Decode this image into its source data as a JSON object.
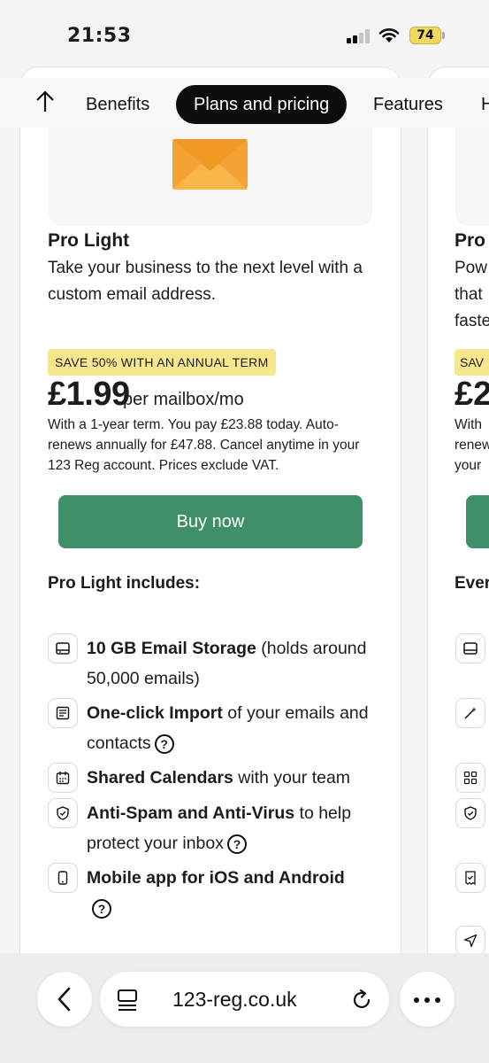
{
  "status_bar": {
    "time": "21:53",
    "battery": "74"
  },
  "nav": {
    "tabs": [
      {
        "label": "Benefits"
      },
      {
        "label": "Plans and pricing"
      },
      {
        "label": "Features"
      }
    ],
    "active_tab": "Plans and pricing",
    "partial_next_tab": "H"
  },
  "plan": {
    "name": "Pro Light",
    "description": "Take your business to the next level with a custom email address.",
    "save_badge": "SAVE 50% WITH AN ANNUAL TERM",
    "price": "£1.99",
    "price_unit": "per mailbox/mo",
    "terms": "With a 1-year term. You pay £23.88 today. Auto-renews annually for £47.88. Cancel anytime in your 123 Reg account. Prices exclude VAT.",
    "buy_label": "Buy now",
    "includes_title": "Pro Light includes:",
    "features": [
      {
        "bold": "10 GB Email Storage",
        "rest": " (holds around 50,000 emails)",
        "help": false,
        "icon": "storage-icon"
      },
      {
        "bold": "One-click Import",
        "rest": " of your emails and contacts",
        "help": true,
        "icon": "import-icon"
      },
      {
        "bold": "Shared Calendars",
        "rest": " with your team",
        "help": false,
        "icon": "calendar-icon"
      },
      {
        "bold": "Anti-Spam and Anti-Virus",
        "rest": " to help protect your inbox",
        "help": true,
        "icon": "shield-icon"
      },
      {
        "bold": "Mobile app for iOS and Android",
        "rest": "",
        "help": true,
        "icon": "mobile-icon"
      }
    ],
    "help_glyph": "?"
  },
  "next_plan_partial": {
    "name": "Pro",
    "desc_lines": [
      "Pow",
      "that",
      "faste"
    ],
    "save_badge": "SAV",
    "price": "£2",
    "terms_lines": [
      "With",
      "renew",
      "your"
    ],
    "includes_title": "Ever"
  },
  "browser": {
    "url": "123-reg.co.uk"
  },
  "colors": {
    "accent_green": "#3f8f69",
    "badge_yellow": "#f6e78e",
    "envelope_orange": "#f3a233",
    "nav_active_bg": "#0d0d0d"
  }
}
